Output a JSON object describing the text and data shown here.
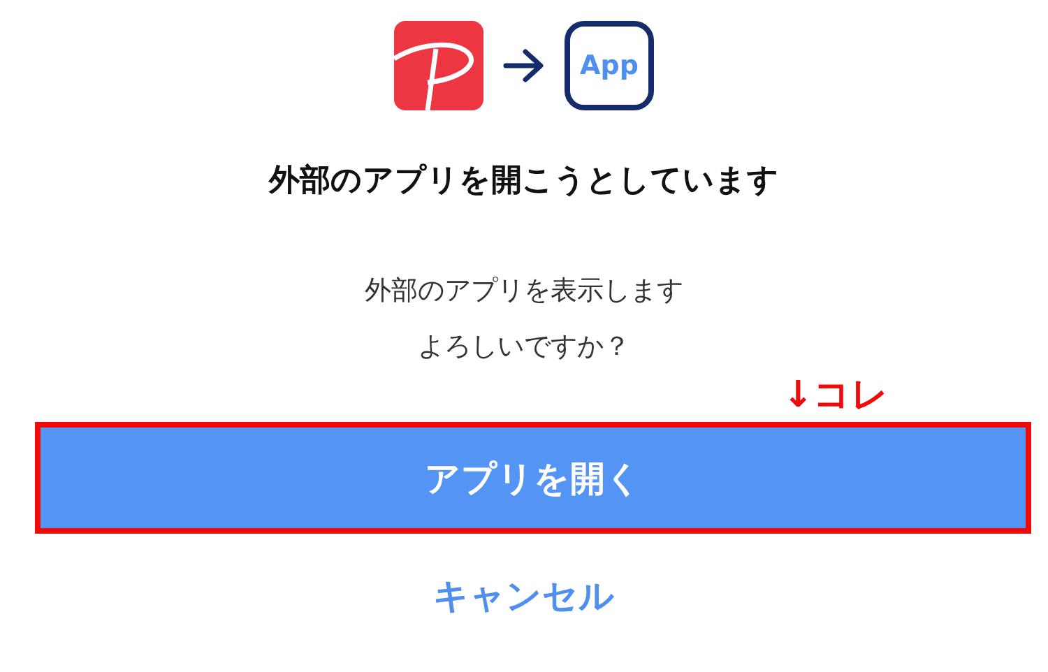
{
  "header": {
    "target_app_label": "App"
  },
  "title": "外部のアプリを開こうとしています",
  "message": [
    "外部のアプリを表示します",
    "よろしいですか？"
  ],
  "annotation": {
    "text": "↓コレ"
  },
  "open_button": {
    "label": "アプリを開く",
    "highlighted": true
  },
  "cancel_button": {
    "label": "キャンセル"
  }
}
